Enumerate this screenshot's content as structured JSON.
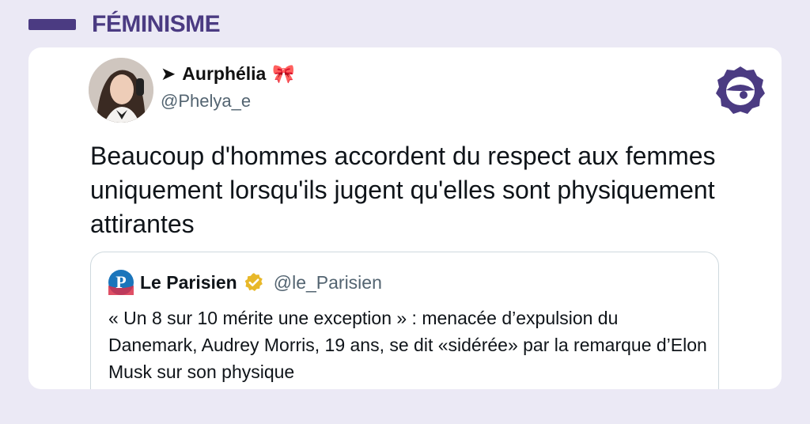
{
  "category": {
    "label": "FÉMINISME"
  },
  "tweet": {
    "author": {
      "arrow": "➤",
      "name": "Aurphélia",
      "emoji": "🎀",
      "handle": "@Phelya_e"
    },
    "text": "Beaucoup d'hommes accordent du respect aux femmes uniquement lorsqu'ils jugent qu'elles sont physiquement attirantes"
  },
  "quoted_tweet": {
    "avatar_letter": "P",
    "name": "Le Parisien",
    "handle": "@le_Parisien",
    "text": "« Un 8 sur 10 mérite une exception » : menacée d’expulsion du Danemark, Audrey Morris, 19 ans, se dit «sidérée» par la remarque d’Elon Musk sur son physique"
  },
  "colors": {
    "page_background": "#ebe9f5",
    "brand_purple": "#4b3b82",
    "verified_gold": "#e8b829",
    "parisien_blue": "#1b75bb"
  }
}
